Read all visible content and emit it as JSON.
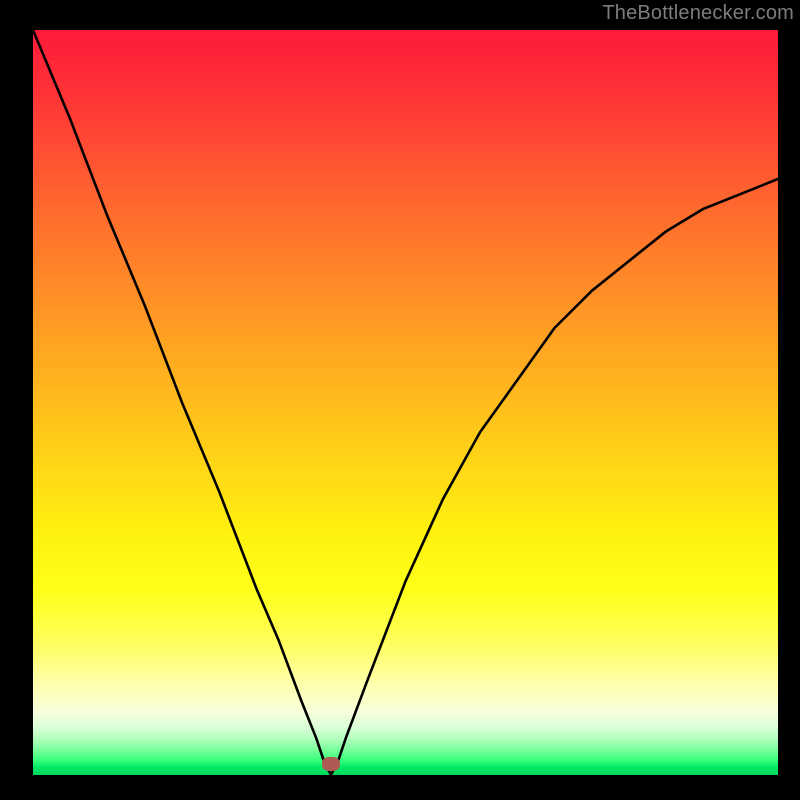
{
  "attribution": "TheBottlenecker.com",
  "chart_data": {
    "type": "line",
    "title": "",
    "xlabel": "",
    "ylabel": "",
    "xlim": [
      0,
      1
    ],
    "ylim": [
      0,
      1
    ],
    "series": [
      {
        "name": "curve",
        "x": [
          0.0,
          0.05,
          0.1,
          0.15,
          0.2,
          0.25,
          0.3,
          0.33,
          0.36,
          0.38,
          0.39,
          0.4,
          0.41,
          0.42,
          0.45,
          0.5,
          0.55,
          0.6,
          0.65,
          0.7,
          0.75,
          0.8,
          0.85,
          0.9,
          0.95,
          1.0
        ],
        "y": [
          1.0,
          0.88,
          0.75,
          0.63,
          0.5,
          0.38,
          0.25,
          0.18,
          0.1,
          0.05,
          0.02,
          0.0,
          0.02,
          0.05,
          0.13,
          0.26,
          0.37,
          0.46,
          0.53,
          0.6,
          0.65,
          0.69,
          0.73,
          0.76,
          0.78,
          0.8
        ]
      }
    ],
    "marker": {
      "x": 0.4,
      "y": 0.015,
      "color": "#b05a55"
    },
    "gradient_stops": [
      {
        "pos": 0.0,
        "color": "#fe1a3a"
      },
      {
        "pos": 0.35,
        "color": "#ff8d27"
      },
      {
        "pos": 0.67,
        "color": "#fff010"
      },
      {
        "pos": 0.92,
        "color": "#f5ffda"
      },
      {
        "pos": 1.0,
        "color": "#00d85c"
      }
    ]
  }
}
